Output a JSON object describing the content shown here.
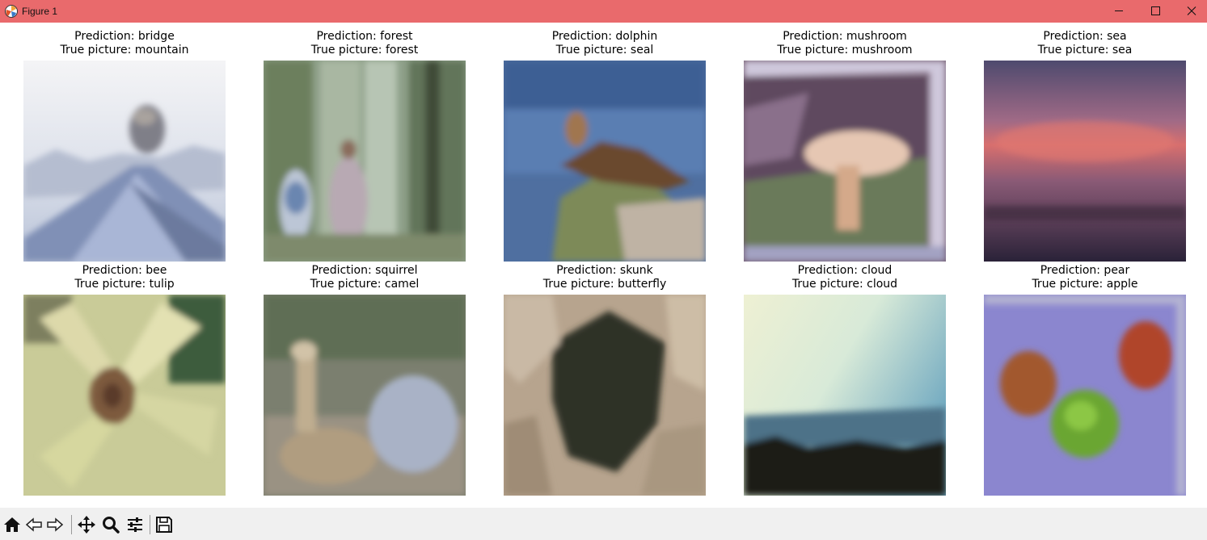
{
  "window": {
    "title": "Figure 1",
    "accent_color": "#e96a6c",
    "controls": [
      "minimize-icon",
      "maximize-icon",
      "close-icon"
    ]
  },
  "figure": {
    "panels": [
      {
        "prediction": "Prediction: bridge",
        "truth": "True picture: mountain"
      },
      {
        "prediction": "Prediction: forest",
        "truth": "True picture: forest"
      },
      {
        "prediction": "Prediction: dolphin",
        "truth": "True picture: seal"
      },
      {
        "prediction": "Prediction: mushroom",
        "truth": "True picture: mushroom"
      },
      {
        "prediction": "Prediction: sea",
        "truth": "True picture: sea"
      },
      {
        "prediction": "Prediction: bee",
        "truth": "True picture: tulip"
      },
      {
        "prediction": "Prediction: squirrel",
        "truth": "True picture: camel"
      },
      {
        "prediction": "Prediction: skunk",
        "truth": "True picture: butterfly"
      },
      {
        "prediction": "Prediction: cloud",
        "truth": "True picture: cloud"
      },
      {
        "prediction": "Prediction: pear",
        "truth": "True picture: apple"
      }
    ]
  },
  "toolbar": {
    "tools": [
      "home-icon",
      "back-arrow-icon",
      "forward-arrow-icon",
      "pan-icon",
      "zoom-icon",
      "configure-subplots-icon",
      "save-icon"
    ]
  }
}
